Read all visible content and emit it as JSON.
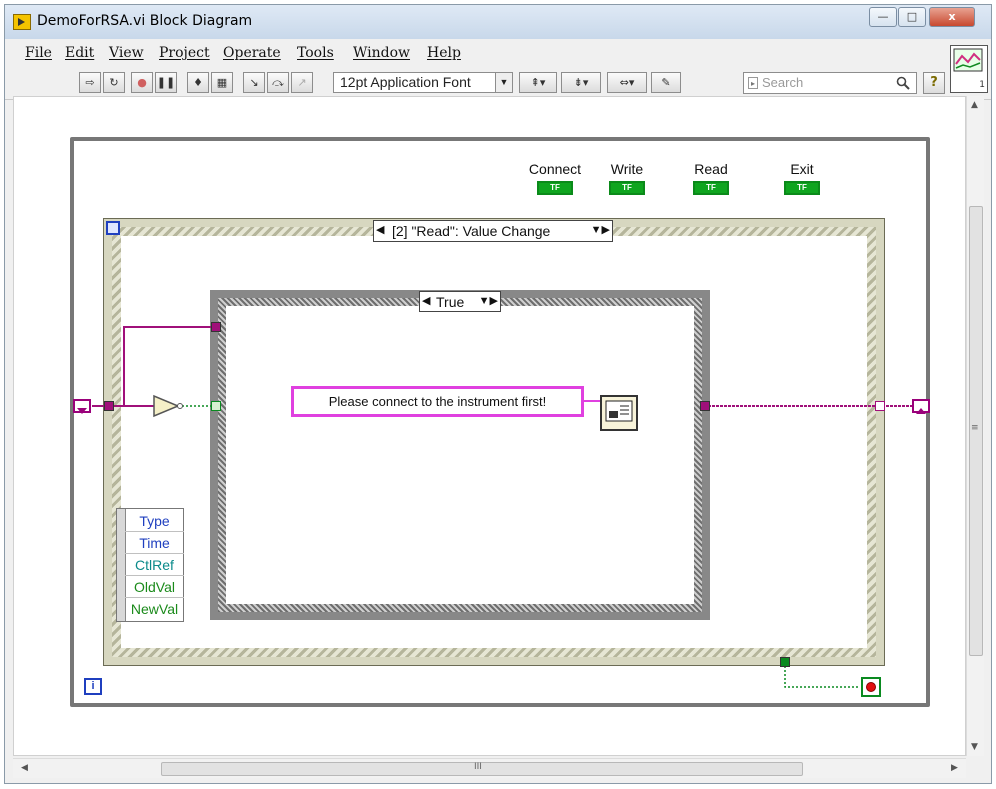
{
  "window": {
    "title": "DemoForRSA.vi Block Diagram",
    "buttons": {
      "minimize": "—",
      "maximize": "□",
      "close": "x"
    }
  },
  "menu": {
    "items": [
      "File",
      "Edit",
      "View",
      "Project",
      "Operate",
      "Tools",
      "Window",
      "Help"
    ]
  },
  "toolbar": {
    "font": "12pt Application Font",
    "search_placeholder": "Search",
    "help": "?"
  },
  "vi_icon": {
    "connector_count": "1"
  },
  "diagram": {
    "controls": [
      "Connect",
      "Write",
      "Read",
      "Exit"
    ],
    "boolean_glyph": "TF",
    "event_selector": "[2] \"Read\": Value Change",
    "case_selector": "True",
    "message": "Please connect to the instrument first!",
    "event_data_nodes": [
      "Type",
      "Time",
      "CtlRef",
      "OldVal",
      "NewVal"
    ],
    "event_data_colors": [
      "#1f3fbf",
      "#1f3fbf",
      "#0a8a8a",
      "#1a8a1a",
      "#1a8a1a"
    ],
    "loop_info": "i"
  },
  "scroll": {
    "h_thumb_label": "III",
    "v_thumb_label": "≡"
  },
  "colors": {
    "wire_pink": "#a0107a",
    "wire_green": "#0a8a20",
    "boolean_green": "#0fa51f",
    "string_pink": "#e040e0"
  }
}
